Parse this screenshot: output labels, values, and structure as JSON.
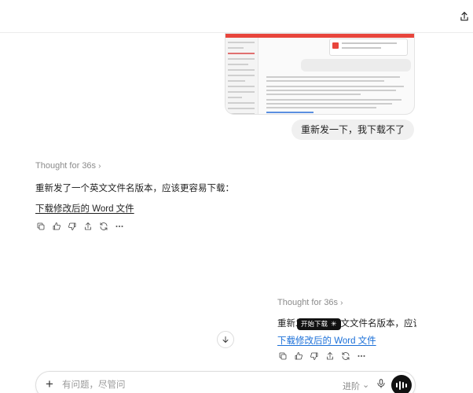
{
  "header": {
    "share_icon": "share-icon"
  },
  "conversation": {
    "user_message": "重新发一下，我下载不了",
    "assistant_main": {
      "thought_label": "Thought for 36s",
      "reply_text": "重新发了一个英文文件名版本，应该更容易下载：",
      "link_text": "下载修改后的 Word 文件"
    },
    "assistant_drag_preview": {
      "thought_label": "Thought for 36s",
      "reply_text": "重新发了一个英文文件名版本，应该更容易下",
      "link_text": "下载修改后的 Word 文件"
    },
    "tooltip": {
      "label": "开始下载"
    }
  },
  "actions": [
    "copy-icon",
    "thumbs-up-icon",
    "thumbs-down-icon",
    "share-icon",
    "regenerate-icon",
    "more-icon"
  ],
  "composer": {
    "placeholder": "有问题，尽管问",
    "mode_label": "进阶",
    "mode_chevron": "⌄"
  },
  "colors": {
    "link_blue": "#1a6fd8",
    "thumb_red": "#e8453c"
  }
}
